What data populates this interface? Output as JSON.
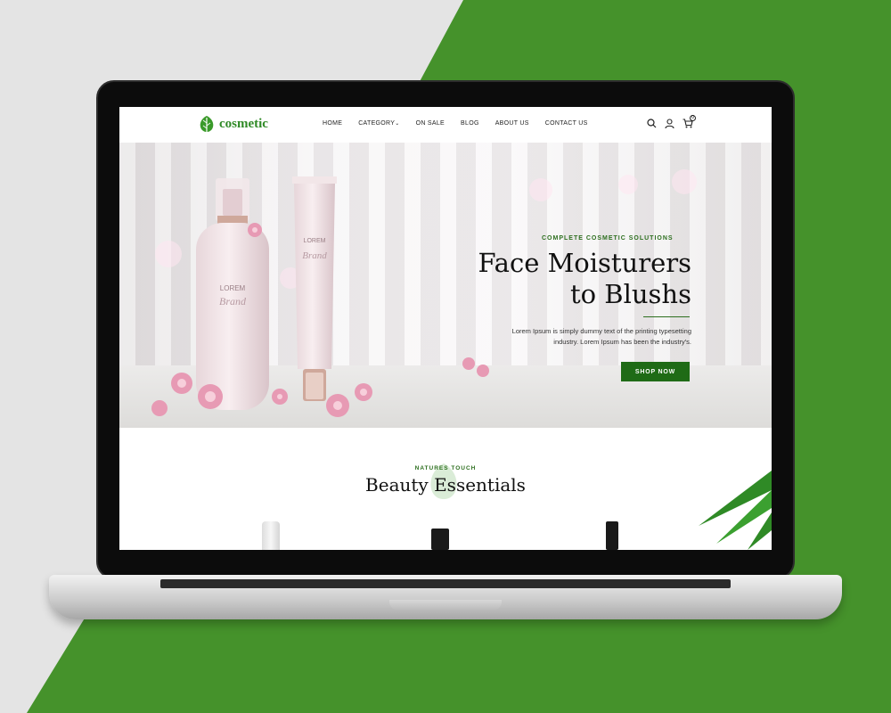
{
  "colors": {
    "green": "#45922b",
    "dark_green": "#1f6b16",
    "bg": "#e4e4e4"
  },
  "header": {
    "logo_text": "cosmetic",
    "logo_icon": "leaf-icon",
    "nav": [
      "HOME",
      "CATEGORY",
      "ON SALE",
      "BLOG",
      "ABOUT US",
      "CONTACT US"
    ],
    "category_chevron": "chevron-down-icon",
    "cart_count": "0",
    "icons": [
      "search-icon",
      "user-icon",
      "cart-icon"
    ]
  },
  "hero": {
    "tagline": "COMPLETE COSMETIC SOLUTIONS",
    "title_line1": "Face Moisturers",
    "title_line2": "to Blushs",
    "description_line1": "Lorem Ipsum is simply dummy text of the printing typesetting",
    "description_line2": "industry. Lorem Ipsum has been the industry's.",
    "cta": "SHOP NOW",
    "bottle_label": "LOREM",
    "bottle_brand": "Brand",
    "tube_label": "LOREM",
    "tube_brand": "Brand"
  },
  "section": {
    "tag": "NATURES TOUCH",
    "title": "Beauty Essentials"
  }
}
